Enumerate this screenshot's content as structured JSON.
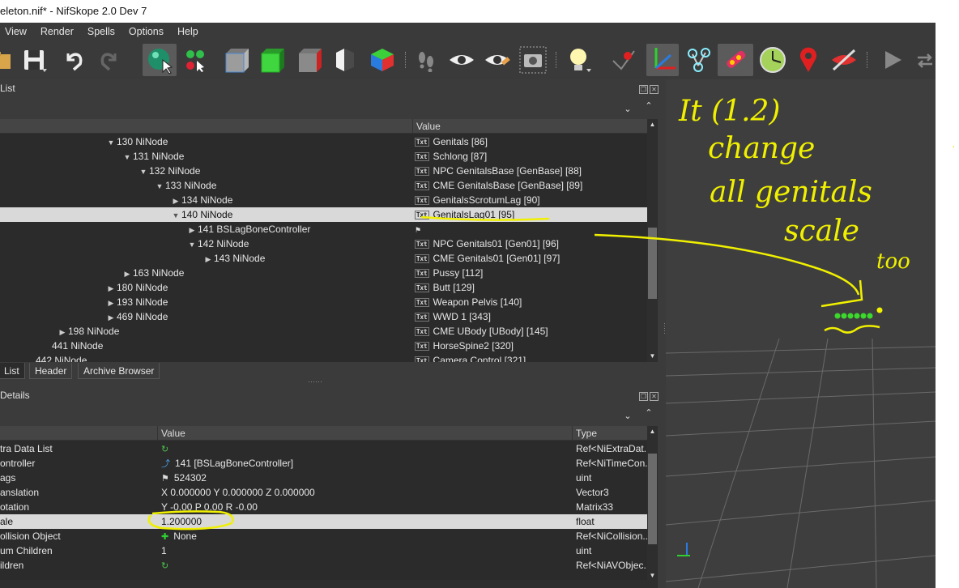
{
  "window": {
    "title": "eleton.nif* - NifSkope 2.0 Dev 7"
  },
  "menu": [
    "View",
    "Render",
    "Spells",
    "Options",
    "Help"
  ],
  "toolbar": {
    "icons": [
      "open-icon",
      "save-icon",
      "undo-icon",
      "redo-icon",
      "select-icon",
      "select-interactive-icon",
      "box-gray-icon",
      "box-green-icon",
      "box-red-icon",
      "box-mono-icon",
      "box-rgb-icon",
      "footprints-icon",
      "eye-icon",
      "eye-pencil-icon",
      "camera-icon",
      "lightbulb-icon",
      "vertex-icon",
      "axes-icon",
      "nodes-icon",
      "glow-icon",
      "clock-icon",
      "marker-icon",
      "hide-icon",
      "play-icon",
      "loop-icon"
    ]
  },
  "blockList": {
    "title": "List",
    "columns": [
      "",
      "Value"
    ],
    "rows": [
      {
        "label": "130 NiNode",
        "value": "Genitals [86]",
        "indent": 130,
        "tri": "down",
        "icon": "txt"
      },
      {
        "label": "131 NiNode",
        "value": "Schlong [87]",
        "indent": 150,
        "tri": "down",
        "icon": "txt"
      },
      {
        "label": "132 NiNode",
        "value": "NPC GenitalsBase [GenBase] [88]",
        "indent": 170,
        "tri": "down",
        "icon": "txt"
      },
      {
        "label": "133 NiNode",
        "value": "CME GenitalsBase [GenBase] [89]",
        "indent": 190,
        "tri": "down",
        "icon": "txt"
      },
      {
        "label": "134 NiNode",
        "value": "GenitalsScrotumLag [90]",
        "indent": 210,
        "tri": "right",
        "icon": "txt"
      },
      {
        "label": "140 NiNode",
        "value": "GenitalsLag01 [95]",
        "indent": 210,
        "tri": "down",
        "icon": "txt",
        "selected": true
      },
      {
        "label": "141 BSLagBoneController",
        "value": "",
        "indent": 230,
        "tri": "right",
        "icon": "flag"
      },
      {
        "label": "142 NiNode",
        "value": "NPC Genitals01 [Gen01] [96]",
        "indent": 230,
        "tri": "down",
        "icon": "txt"
      },
      {
        "label": "143 NiNode",
        "value": "CME Genitals01 [Gen01] [97]",
        "indent": 250,
        "tri": "right",
        "icon": "txt"
      },
      {
        "label": "163 NiNode",
        "value": "Pussy [112]",
        "indent": 150,
        "tri": "right",
        "icon": "txt"
      },
      {
        "label": "180 NiNode",
        "value": "Butt [129]",
        "indent": 130,
        "tri": "right",
        "icon": "txt"
      },
      {
        "label": "193 NiNode",
        "value": "Weapon Pelvis [140]",
        "indent": 130,
        "tri": "right",
        "icon": "txt"
      },
      {
        "label": "469 NiNode",
        "value": "WWD 1 [343]",
        "indent": 130,
        "tri": "right",
        "icon": "txt"
      },
      {
        "label": "198 NiNode",
        "value": "CME UBody [UBody] [145]",
        "indent": 70,
        "tri": "right",
        "icon": "txt"
      },
      {
        "label": "441 NiNode",
        "value": "HorseSpine2 [320]",
        "indent": 50,
        "tri": "",
        "icon": "txt"
      },
      {
        "label": "442 NiNode",
        "value": "Camera Control [321]",
        "indent": 30,
        "tri": "",
        "icon": "txt"
      }
    ]
  },
  "tabs": [
    "List",
    "Header",
    "Archive Browser"
  ],
  "blockDetails": {
    "title": "Details",
    "columns": [
      "",
      "Value",
      "Type"
    ],
    "rows": [
      {
        "name": "tra Data List",
        "value": "",
        "type": "Ref<NiExtraDat...",
        "icon": "refresh"
      },
      {
        "name": "ontroller",
        "value": "141 [BSLagBoneController]",
        "type": "Ref<NiTimeCon...",
        "icon": "link"
      },
      {
        "name": "ags",
        "value": "524302",
        "type": "uint",
        "icon": "flag"
      },
      {
        "name": "anslation",
        "value": "X 0.000000 Y 0.000000 Z 0.000000",
        "type": "Vector3",
        "icon": ""
      },
      {
        "name": "otation",
        "value": "Y -0.00 P 0.00 R -0.00",
        "type": "Matrix33",
        "icon": ""
      },
      {
        "name": "ale",
        "value": "1.200000",
        "type": "float",
        "icon": "",
        "selected": true
      },
      {
        "name": "ollision Object",
        "value": "None",
        "type": "Ref<NiCollision...",
        "icon": "plus"
      },
      {
        "name": "um Children",
        "value": "1",
        "type": "uint",
        "icon": ""
      },
      {
        "name": "ildren",
        "value": "",
        "type": "Ref<NiAVObjec...",
        "icon": "refresh"
      }
    ]
  },
  "annotation": {
    "lines": [
      "It (1.2)",
      "change",
      "all genitals",
      "scale",
      "too"
    ],
    "color": "#f0f000"
  }
}
